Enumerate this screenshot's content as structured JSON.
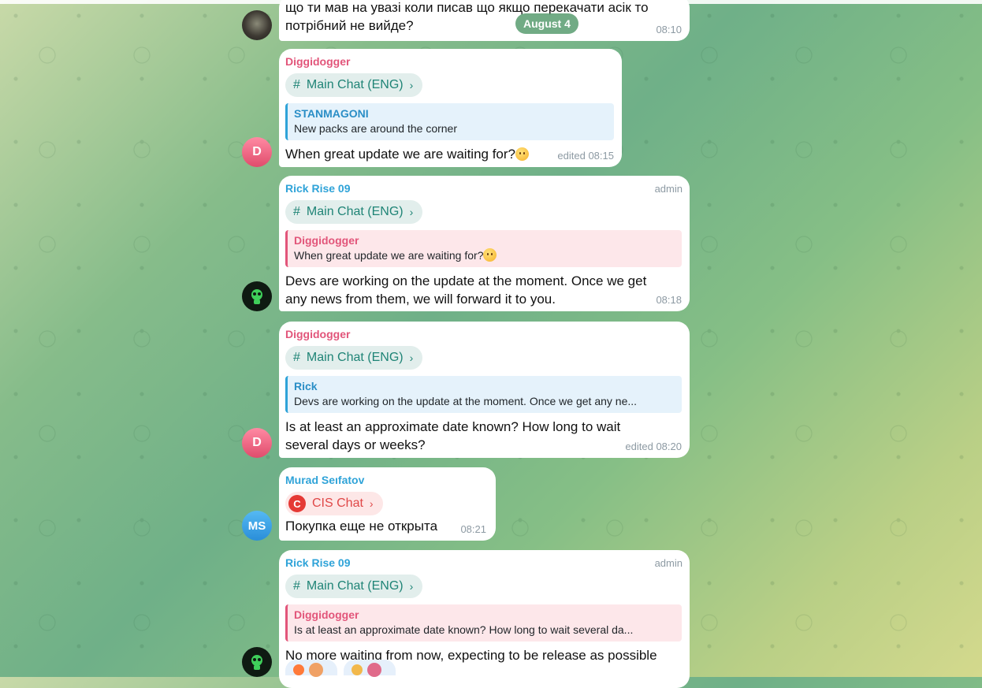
{
  "date_pill": "August 4",
  "messages": [
    {
      "text": "що ти мав на увазі коли писав що якщо перекачати асік то потрібний не вийде?",
      "time": "08:10",
      "avatar_icon": "user-photo-avatar"
    },
    {
      "sender": "Diggidogger",
      "topic": "Main Chat (ENG)",
      "reply_name": "STANMAGONI",
      "reply_text": "New packs are around the corner",
      "text": "When great update we are waiting for?",
      "time": "edited 08:15",
      "avatar": "D"
    },
    {
      "sender": "Rick Rise 09",
      "badge": "admin",
      "topic": "Main Chat (ENG)",
      "reply_name": "Diggidogger",
      "reply_text": "When great update we are waiting for?",
      "text": "Devs are working on the update at the moment. Once we get any news from them, we will forward it to you.",
      "time": "08:18",
      "avatar_icon": "green-alien-avatar"
    },
    {
      "sender": "Diggidogger",
      "topic": "Main Chat (ENG)",
      "reply_name": "Rick",
      "reply_text": "Devs are working on the update at the moment. Once we get any ne...",
      "text": "Is at least an approximate date known? How long to wait several days or weeks?",
      "time": "edited 08:20",
      "avatar": "D"
    },
    {
      "sender": "Murad Seıfatov",
      "topic": "CIS Chat",
      "topic_icon_letter": "C",
      "text": "Покупка еще не открыта",
      "time": "08:21",
      "avatar": "MS"
    },
    {
      "sender": "Rick Rise 09",
      "badge": "admin",
      "topic": "Main Chat (ENG)",
      "reply_name": "Diggidogger",
      "reply_text": "Is at least an approximate date known? How long to wait several da...",
      "text": "No more waiting from now, expecting to be release as possible",
      "avatar_icon": "green-alien-avatar"
    }
  ],
  "glyphs": {
    "hash": "#",
    "chevron": "›"
  },
  "colors": {
    "sender_pink": "#e2557a",
    "sender_blue": "#2fa3d8",
    "topic_green": "#1f8476",
    "topic_red": "#e04747"
  }
}
